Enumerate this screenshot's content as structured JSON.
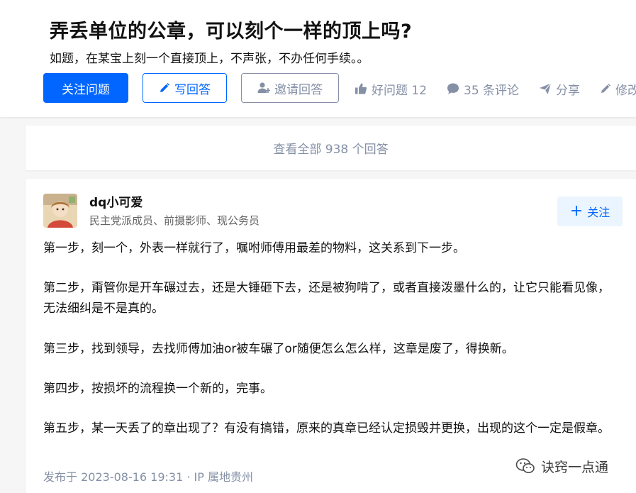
{
  "question": {
    "title": "弄丢单位的公章，可以刻个一样的顶上吗?",
    "detail": "如题，在某宝上刻一个直接顶上，不声张，不办任何手续。。"
  },
  "actions": {
    "follow_label": "关注问题",
    "write_label": "写回答",
    "invite_label": "邀请回答",
    "good_question": "好问题 12",
    "comments": "35 条评论",
    "share": "分享",
    "edit": "修改"
  },
  "view_all": "查看全部 938 个回答",
  "answer": {
    "author": {
      "name": "dq小可爱",
      "bio": "民主党派成员、前摄影师、现公务员",
      "follow_label": "关注"
    },
    "paragraphs": [
      "第一步，刻一个，外表一样就行了，嘱咐师傅用最差的物料，这关系到下一步。",
      "第二步，甭管你是开车碾过去，还是大锤砸下去，还是被狗啃了，或者直接泼墨什么的，让它只能看见像，无法细纠是不是真的。",
      "第三步，找到领导，去找师傅加油or被车碾了or随便怎么怎么样，这章是废了，得换新。",
      "第四步，按损坏的流程换一个新的，完事。",
      "第五步，某一天丢了的章出现了？有没有搞错，原来的真章已经认定损毁并更换，出现的这个一定是假章。"
    ],
    "published": "发布于 2023-08-16 19:31 · IP 属地贵州"
  },
  "watermark": "诀窍一点通",
  "icons": {
    "write": "pencil-icon",
    "invite": "add-user-icon",
    "good_question": "thumbs-up-icon",
    "comments": "comment-bubble-icon",
    "share": "paper-plane-icon",
    "edit": "pencil-icon",
    "watermark": "wechat-icon"
  },
  "colors": {
    "primary": "#0066ff",
    "muted": "#8590a6",
    "text": "#121212",
    "follow_bg": "#ebf5ff"
  }
}
